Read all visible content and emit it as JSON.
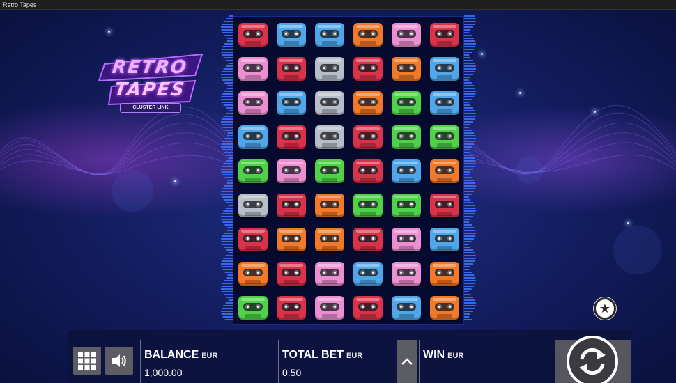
{
  "window": {
    "title": "Retro Tapes"
  },
  "logo": {
    "line1": "RETRO",
    "line2": "TAPES",
    "tag": "CLUSTER LINK"
  },
  "colors": {
    "red": "#d8334a",
    "blue": "#4fa6e8",
    "grey": "#b8bec8",
    "orange": "#f0792a",
    "pink": "#ec8fd0",
    "green": "#4fd24a"
  },
  "grid": {
    "columns": 6,
    "rows": 9,
    "symbols": [
      [
        "red",
        "blue",
        "blue",
        "orange",
        "pink",
        "red"
      ],
      [
        "pink",
        "red",
        "grey",
        "red",
        "orange",
        "blue"
      ],
      [
        "pink",
        "blue",
        "grey",
        "orange",
        "green",
        "blue"
      ],
      [
        "blue",
        "red",
        "grey",
        "red",
        "green",
        "green"
      ],
      [
        "green",
        "pink",
        "green",
        "red",
        "blue",
        "orange"
      ],
      [
        "grey",
        "red",
        "orange",
        "green",
        "green",
        "red"
      ],
      [
        "red",
        "orange",
        "orange",
        "red",
        "pink",
        "blue"
      ],
      [
        "orange",
        "red",
        "pink",
        "blue",
        "pink",
        "orange"
      ],
      [
        "green",
        "red",
        "pink",
        "red",
        "blue",
        "orange"
      ]
    ]
  },
  "controls": {
    "menu_icon": "grid-menu-icon",
    "sound_icon": "speaker-icon",
    "favorite_icon": "star-icon",
    "bet_up_icon": "chevron-up-icon",
    "spin_icon": "refresh-icon",
    "balance": {
      "label": "BALANCE",
      "unit": "EUR",
      "value": "1,000.00"
    },
    "total_bet": {
      "label": "TOTAL BET",
      "unit": "EUR",
      "value": "0.50"
    },
    "win": {
      "label": "WIN",
      "unit": "EUR",
      "value": ""
    }
  }
}
